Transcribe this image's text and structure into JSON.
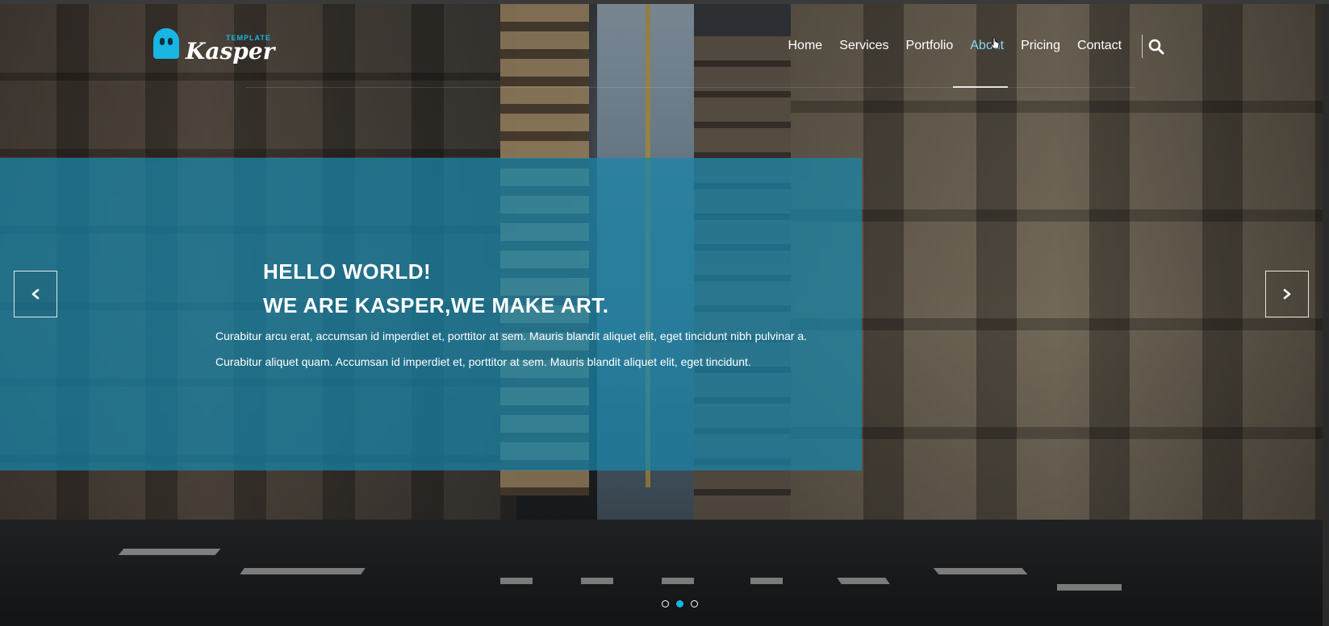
{
  "brand": {
    "small_label": "TEMPLATE",
    "name": "Kasper",
    "accent": "#19b5e3"
  },
  "nav": {
    "items": [
      {
        "label": "Home"
      },
      {
        "label": "Services"
      },
      {
        "label": "Portfolio"
      },
      {
        "label": "About"
      },
      {
        "label": "Pricing"
      },
      {
        "label": "Contact"
      }
    ],
    "active_index": 3,
    "search_icon": "search-icon"
  },
  "hero": {
    "title_line1": "HELLO WORLD!",
    "title_line2": "WE ARE KASPER,WE MAKE ART.",
    "paragraph_line1": "Curabitur arcu erat, accumsan id imperdiet et, porttitor at sem. Mauris blandit aliquet elit, eget tincidunt nibh pulvinar a.",
    "paragraph_line2": "Curabitur aliquet quam. Accumsan id imperdiet et, porttitor at sem. Mauris blandit aliquet elit, eget tincidunt.",
    "panel_color": "#1785aa",
    "prev_icon": "chevron-left-icon",
    "next_icon": "chevron-right-icon"
  },
  "slider": {
    "slide_count": 3,
    "active_slide": 2
  }
}
